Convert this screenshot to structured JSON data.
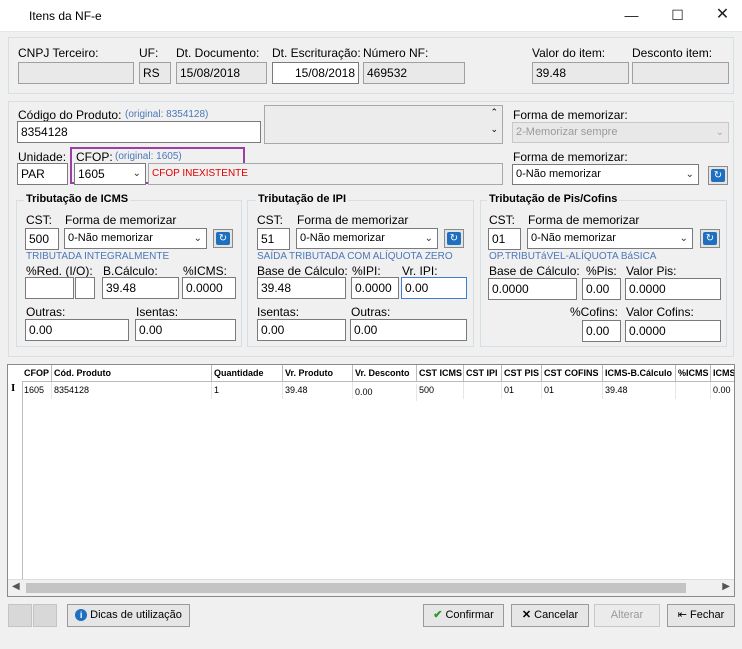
{
  "window": {
    "title": "Itens da NF-e"
  },
  "header": {
    "cnpj_label": "CNPJ Terceiro:",
    "cnpj_value": "",
    "uf_label": "UF:",
    "uf_value": "RS",
    "dt_doc_label": "Dt. Documento:",
    "dt_doc_value": "15/08/2018",
    "dt_escr_label": "Dt. Escrituração:",
    "dt_escr_value": "15/08/2018",
    "numero_label": "Número NF:",
    "numero_value": "469532",
    "valor_label": "Valor do item:",
    "valor_value": "39.48",
    "desconto_label": "Desconto item:",
    "desconto_value": ""
  },
  "produto": {
    "codigo_label": "Código do Produto:",
    "codigo_original": "(original: 8354128)",
    "codigo_value": "8354128",
    "memorizar_label": "Forma de memorizar:",
    "memorizar_value": "2-Memorizar sempre",
    "unidade_label": "Unidade:",
    "unidade_value": "PAR",
    "cfop_label": "CFOP:",
    "cfop_original": "(original: 1605)",
    "cfop_value": "1605",
    "cfop_status": "CFOP INEXISTENTE",
    "memorizar2_label": "Forma de memorizar:",
    "memorizar2_value": "0-Não memorizar"
  },
  "icms": {
    "title": "Tributação de ICMS",
    "cst_label": "CST:",
    "cst_value": "500",
    "memorizar_label": "Forma de memorizar",
    "memorizar_value": "0-Não memorizar",
    "desc": "TRIBUTADA INTEGRALMENTE",
    "red_label": "%Red. (I/O):",
    "red_in": "",
    "red_out": "",
    "bc_label": "B.Cálculo:",
    "bc_value": "39.48",
    "pct_label": "%ICMS:",
    "pct_value": "0.0000",
    "outras_label": "Outras:",
    "outras_value": "0.00",
    "isentas_label": "Isentas:",
    "isentas_value": "0.00"
  },
  "ipi": {
    "title": "Tributação de IPI",
    "cst_label": "CST:",
    "cst_value": "51",
    "memorizar_label": "Forma de memorizar",
    "memorizar_value": "0-Não memorizar",
    "desc": "SAÍDA TRIBUTADA COM ALÍQUOTA ZERO",
    "bc_label": "Base de Cálculo:",
    "bc_value": "39.48",
    "pct_label": "%IPI:",
    "pct_value": "0.0000",
    "vr_label": "Vr. IPI:",
    "vr_value": "0.00",
    "isentas_label": "Isentas:",
    "isentas_value": "0.00",
    "outras_label": "Outras:",
    "outras_value": "0.00"
  },
  "piscofins": {
    "title": "Tributação de Pis/Cofins",
    "cst_label": "CST:",
    "cst_value": "01",
    "memorizar_label": "Forma de memorizar",
    "memorizar_value": "0-Não memorizar",
    "desc": "OP.TRIBUTáVEL-ALÍQUOTA BáSICA",
    "bc_label": "Base de Cálculo:",
    "bc_value": "0.0000",
    "pis_pct_label": "%Pis:",
    "pis_pct_value": "0.00",
    "pis_val_label": "Valor Pis:",
    "pis_val_value": "0.0000",
    "cofins_pct_label": "%Cofins:",
    "cofins_pct_value": "0.00",
    "cofins_val_label": "Valor Cofins:",
    "cofins_val_value": "0.0000"
  },
  "grid": {
    "columns": [
      "CFOP",
      "Cód. Produto",
      "Quantidade",
      "Vr. Produto",
      "Vr. Desconto",
      "CST ICMS",
      "CST IPI",
      "CST PIS",
      "CST COFINS",
      "ICMS-B.Cálculo",
      "%ICMS",
      "ICMS"
    ],
    "rows": [
      [
        "1605",
        "8354128",
        "1",
        "39.48",
        "0.00",
        "500",
        "",
        "01",
        "01",
        "39.48",
        "",
        "0.00"
      ]
    ]
  },
  "buttons": {
    "dicas": "Dicas de utilização",
    "confirmar": "Confirmar",
    "cancelar": "Cancelar",
    "alterar": "Alterar",
    "fechar": "Fechar"
  },
  "colors": {
    "cfop_highlight": "#9b3fa6",
    "status_red": "#e00000",
    "hint_blue": "#4a78b8"
  }
}
